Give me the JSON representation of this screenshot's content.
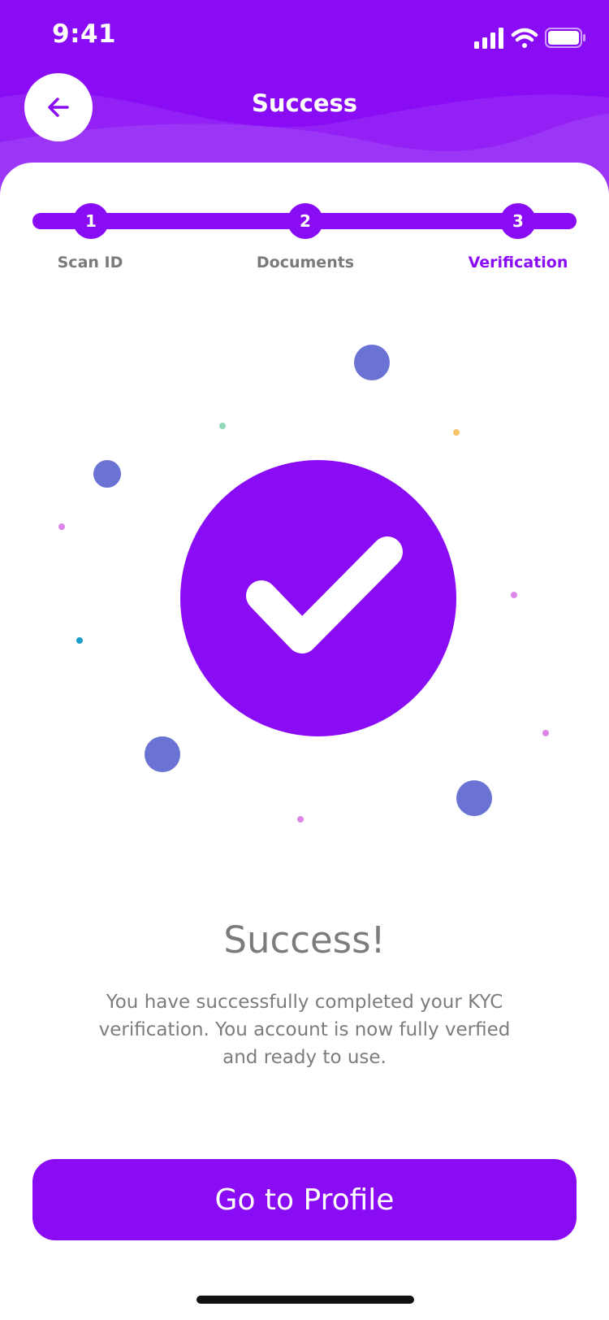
{
  "status_bar": {
    "time": "9:41"
  },
  "header": {
    "title": "Success",
    "back_icon": "arrow-left-icon"
  },
  "stepper": {
    "steps": [
      {
        "number": "1",
        "label": "Scan ID",
        "active": false
      },
      {
        "number": "2",
        "label": "Documents",
        "active": false
      },
      {
        "number": "3",
        "label": "Verification",
        "active": true
      }
    ]
  },
  "result": {
    "icon": "check-icon",
    "title": "Success!",
    "description": "You have successfully completed your KYC verification. You account is now fully verfied and ready to use."
  },
  "actions": {
    "primary_label": "Go to Profile"
  },
  "colors": {
    "primary": "#8a0cf4",
    "text_gray": "#7c7c7c",
    "confetti_blue": "#6a72d4",
    "confetti_pink": "#dc86e8",
    "confetti_teal": "#8fd8b8",
    "confetti_yellow": "#f3c46b",
    "confetti_cyan": "#1a9dc9"
  }
}
